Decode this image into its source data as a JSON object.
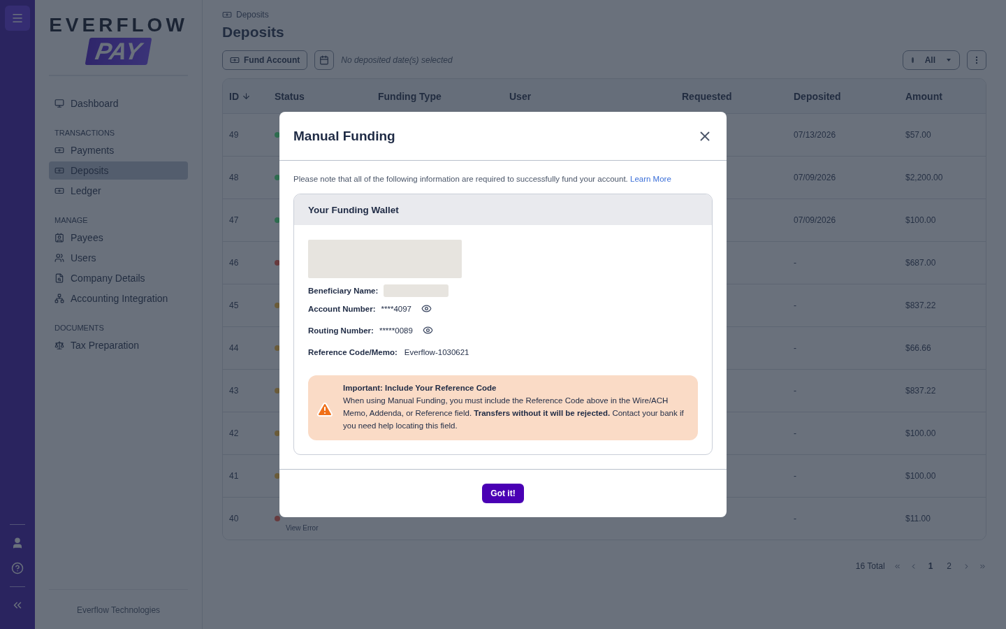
{
  "logo": {
    "wordmark": "EVERFLOW",
    "badge": "PAY"
  },
  "sidebar": {
    "sections": [
      {
        "items": [
          {
            "label": "Dashboard",
            "selected": false
          }
        ]
      },
      {
        "heading": "TRANSACTIONS",
        "items": [
          {
            "label": "Payments",
            "selected": false
          },
          {
            "label": "Deposits",
            "selected": true
          },
          {
            "label": "Ledger",
            "selected": false
          }
        ]
      },
      {
        "heading": "MANAGE",
        "items": [
          {
            "label": "Payees",
            "selected": false
          },
          {
            "label": "Users",
            "selected": false
          },
          {
            "label": "Company Details",
            "selected": false
          },
          {
            "label": "Accounting Integration",
            "selected": false
          }
        ]
      },
      {
        "heading": "DOCUMENTS",
        "items": [
          {
            "label": "Tax Preparation",
            "selected": false
          }
        ]
      }
    ],
    "footer": "Everflow Technologies"
  },
  "breadcrumb": "Deposits",
  "title": "Deposits",
  "toolbar": {
    "fund_button": "Fund Account",
    "date_hint": "No deposited date(s) selected",
    "filter": "All"
  },
  "table": {
    "columns": [
      "ID",
      "Status",
      "Funding Type",
      "User",
      "Requested",
      "Deposited",
      "Amount"
    ],
    "rows": [
      {
        "id": "49",
        "color": "#2e6b4f",
        "deposited": "07/13/2026",
        "amount": "$57.00"
      },
      {
        "id": "48",
        "color": "#2e6b4f",
        "deposited": "07/09/2026",
        "amount": "$2,200.00"
      },
      {
        "id": "47",
        "color": "#2e6b4f",
        "deposited": "07/09/2026",
        "amount": "$100.00"
      },
      {
        "id": "46",
        "color": "#663a3e",
        "deposited": "-",
        "amount": "$687.00"
      },
      {
        "id": "45",
        "color": "#695a3a",
        "deposited": "-",
        "amount": "$837.22"
      },
      {
        "id": "44",
        "color": "#695a3a",
        "deposited": "-",
        "amount": "$66.66"
      },
      {
        "id": "43",
        "color": "#695a3a",
        "deposited": "-",
        "amount": "$837.22"
      },
      {
        "id": "42",
        "color": "#695a3a",
        "deposited": "-",
        "amount": "$100.00"
      },
      {
        "id": "41",
        "color": "#695a3a",
        "deposited": "-",
        "amount": "$100.00"
      },
      {
        "id": "40",
        "color": "#663a3e",
        "deposited": "-",
        "amount": "$11.00",
        "note": "View Error"
      }
    ]
  },
  "pagination": {
    "total": "16 Total",
    "pages": [
      {
        "label": "1",
        "selected": true
      },
      {
        "label": "2",
        "selected": false
      }
    ]
  },
  "modal": {
    "title": "Manual Funding",
    "note": "Please note that all of the following information are required to successfully fund your account.",
    "link": "Learn More",
    "wallet": {
      "title": "Your Funding Wallet",
      "fields": [
        {
          "label": "Beneficiary Name:",
          "kind": "redacted"
        },
        {
          "label": "Account Number:",
          "kind": "masked",
          "value": "****4097"
        },
        {
          "label": "Routing Number:",
          "kind": "masked",
          "value": "*****0089"
        },
        {
          "label": "Reference Code/Memo:",
          "kind": "text",
          "value": "Everflow-1030621"
        }
      ],
      "alert": {
        "title": "Important: Include Your Reference Code",
        "text": "When using Manual Funding, you must include the Reference Code above in the Wire/ACH Memo, Addenda, or Reference field. **Transfers without it will be rejected.** Contact your bank if you need help locating this field."
      }
    },
    "button": "Got it!"
  }
}
